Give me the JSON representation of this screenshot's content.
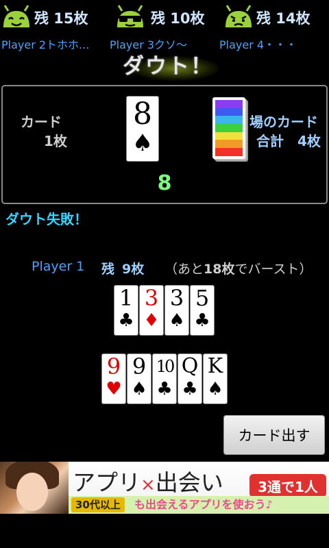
{
  "opponents": [
    {
      "name": "Player 2トホホ...",
      "remaining": "残 15枚",
      "face": "happy-robot-icon"
    },
    {
      "name": "Player 3クソ～",
      "remaining": "残 10枚",
      "face": "sunglasses-robot-icon"
    },
    {
      "name": "Player 4・・・",
      "remaining": "残 14枚",
      "face": "worried-robot-icon"
    }
  ],
  "title": "ダウト！",
  "panel": {
    "card_label": "カード",
    "card_count": "1枚",
    "played_card": {
      "rank": "8",
      "suit": "♠",
      "color": "black"
    },
    "pile_label": "場のカード",
    "pile_total": "合計　4枚",
    "current_number": "8"
  },
  "message": "ダウト失敗！",
  "player": {
    "name": "Player 1",
    "remaining_prefix": "残",
    "remaining": "9枚",
    "burst_note_prefix": "（あと",
    "burst_count": "18枚",
    "burst_note_suffix": "でバースト）"
  },
  "hand_row1": [
    {
      "rank": "1",
      "suit": "♣",
      "color": "black"
    },
    {
      "rank": "3",
      "suit": "♦",
      "color": "red"
    },
    {
      "rank": "3",
      "suit": "♠",
      "color": "black"
    },
    {
      "rank": "5",
      "suit": "♣",
      "color": "black"
    }
  ],
  "hand_row2": [
    {
      "rank": "9",
      "suit": "♥",
      "color": "red"
    },
    {
      "rank": "9",
      "suit": "♠",
      "color": "black"
    },
    {
      "rank": "10",
      "suit": "♣",
      "color": "black"
    },
    {
      "rank": "Q",
      "suit": "♣",
      "color": "black"
    },
    {
      "rank": "K",
      "suit": "♠",
      "color": "black"
    }
  ],
  "play_button": "カード出す",
  "ad": {
    "headline_left": "アプリ",
    "headline_x": "×",
    "headline_right": "出会い",
    "badge": "3通で1人",
    "age_tag": "30代以上",
    "subline": "も出会えるアプリを使おう♪"
  },
  "colors": {
    "accent_blue": "#4aa3ff",
    "sum_green": "#7dff7d",
    "message_cyan": "#33d6ff",
    "robot_green": "#9bd23c",
    "deck_stripes": [
      "#8a3cf0",
      "#3c5cf0",
      "#3cb4f0",
      "#3cd03c",
      "#f0e03c",
      "#f09a28",
      "#f03228"
    ]
  }
}
